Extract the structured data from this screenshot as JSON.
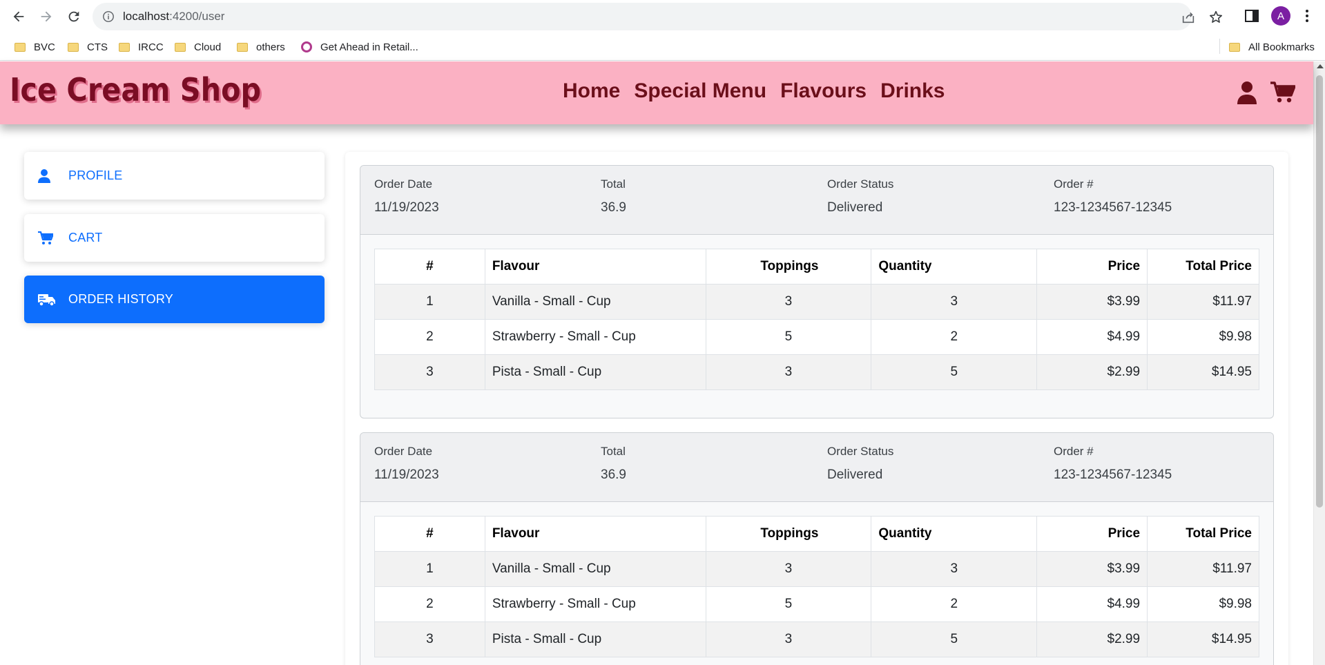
{
  "browser": {
    "url_host": "localhost",
    "url_rest": ":4200/user",
    "profile_initial": "A",
    "bookmarks": [
      "BVC",
      "CTS",
      "IRCC",
      "Cloud",
      "others",
      "Get Ahead in Retail..."
    ],
    "all_bookmarks": "All Bookmarks"
  },
  "site": {
    "brand": "Ice Cream Shop",
    "nav": [
      "Home",
      "Special Menu",
      "Flavours",
      "Drinks"
    ]
  },
  "sidebar": {
    "items": [
      {
        "label": "PROFILE",
        "icon": "person-icon",
        "active": false
      },
      {
        "label": "CART",
        "icon": "cart-icon",
        "active": false
      },
      {
        "label": "ORDER HISTORY",
        "icon": "truck-icon",
        "active": true
      }
    ]
  },
  "order_header_labels": {
    "date": "Order Date",
    "total": "Total",
    "status": "Order Status",
    "number": "Order #"
  },
  "table_headers": [
    "#",
    "Flavour",
    "Toppings",
    "Quantity",
    "Price",
    "Total Price"
  ],
  "orders": [
    {
      "date": "11/19/2023",
      "total": "36.9",
      "status": "Delivered",
      "number": "123-1234567-12345",
      "items": [
        {
          "idx": "1",
          "flavour": "Vanilla - Small - Cup",
          "toppings": "3",
          "quantity": "3",
          "price": "$3.99",
          "total": "$11.97"
        },
        {
          "idx": "2",
          "flavour": "Strawberry - Small - Cup",
          "toppings": "5",
          "quantity": "2",
          "price": "$4.99",
          "total": "$9.98"
        },
        {
          "idx": "3",
          "flavour": "Pista - Small - Cup",
          "toppings": "3",
          "quantity": "5",
          "price": "$2.99",
          "total": "$14.95"
        }
      ]
    },
    {
      "date": "11/19/2023",
      "total": "36.9",
      "status": "Delivered",
      "number": "123-1234567-12345",
      "items": [
        {
          "idx": "1",
          "flavour": "Vanilla - Small - Cup",
          "toppings": "3",
          "quantity": "3",
          "price": "$3.99",
          "total": "$11.97"
        },
        {
          "idx": "2",
          "flavour": "Strawberry - Small - Cup",
          "toppings": "5",
          "quantity": "2",
          "price": "$4.99",
          "total": "$9.98"
        },
        {
          "idx": "3",
          "flavour": "Pista - Small - Cup",
          "toppings": "3",
          "quantity": "5",
          "price": "$2.99",
          "total": "$14.95"
        }
      ]
    }
  ],
  "colors": {
    "header_bg": "#fbb1c3",
    "brand_text": "#7a0d24",
    "accent": "#0d6efd"
  }
}
